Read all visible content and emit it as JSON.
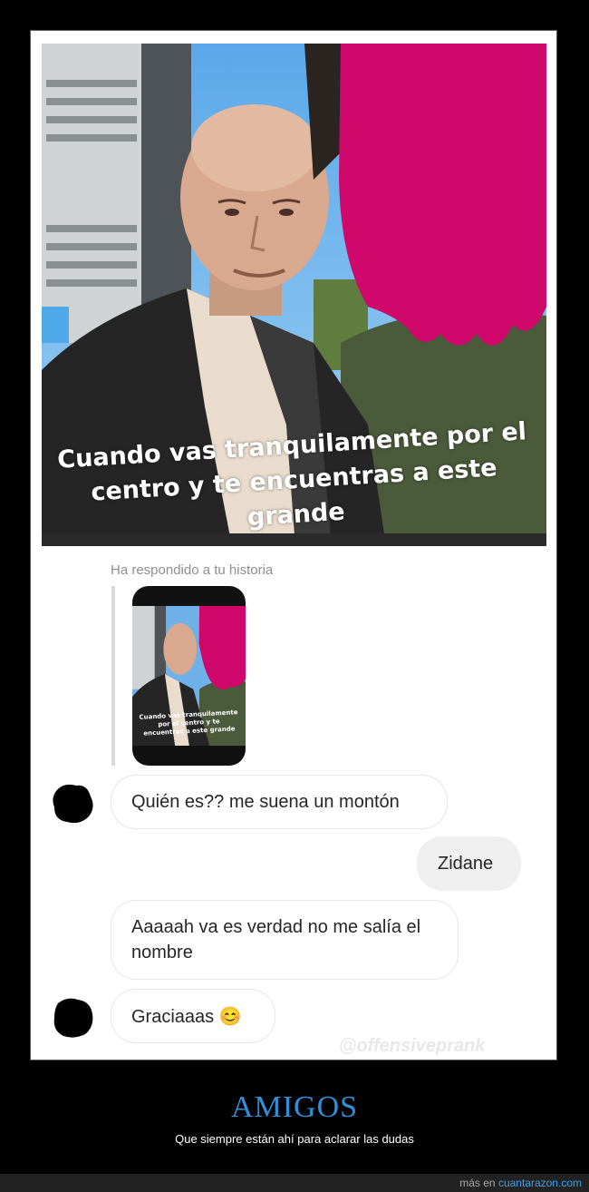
{
  "story": {
    "caption": "Cuando vas tranquilamente por el centro y te encuentras a este grande"
  },
  "conversation": {
    "reply_label": "Ha respondido a tu historia",
    "thumb_caption": "Cuando vas tranquilamente por el centro y te encuentras a este grande",
    "messages": [
      {
        "from": "them",
        "text": "Quién es?? me suena un montón"
      },
      {
        "from": "me",
        "text": "Zidane"
      },
      {
        "from": "them",
        "text": "Aaaaah va es verdad no me salía el nombre"
      },
      {
        "from": "them",
        "text": "Graciaaas 😊"
      }
    ],
    "watermark": "@offensiveprank"
  },
  "footer": {
    "title": "AMIGOS",
    "subtitle": "Que siempre están ahí para aclarar las dudas",
    "more_prefix": "más en",
    "more_link": "cuantarazon.com"
  },
  "colors": {
    "accent": "#2f8fd8",
    "redaction": "#d0086c",
    "bubble_out": "#efefef"
  }
}
